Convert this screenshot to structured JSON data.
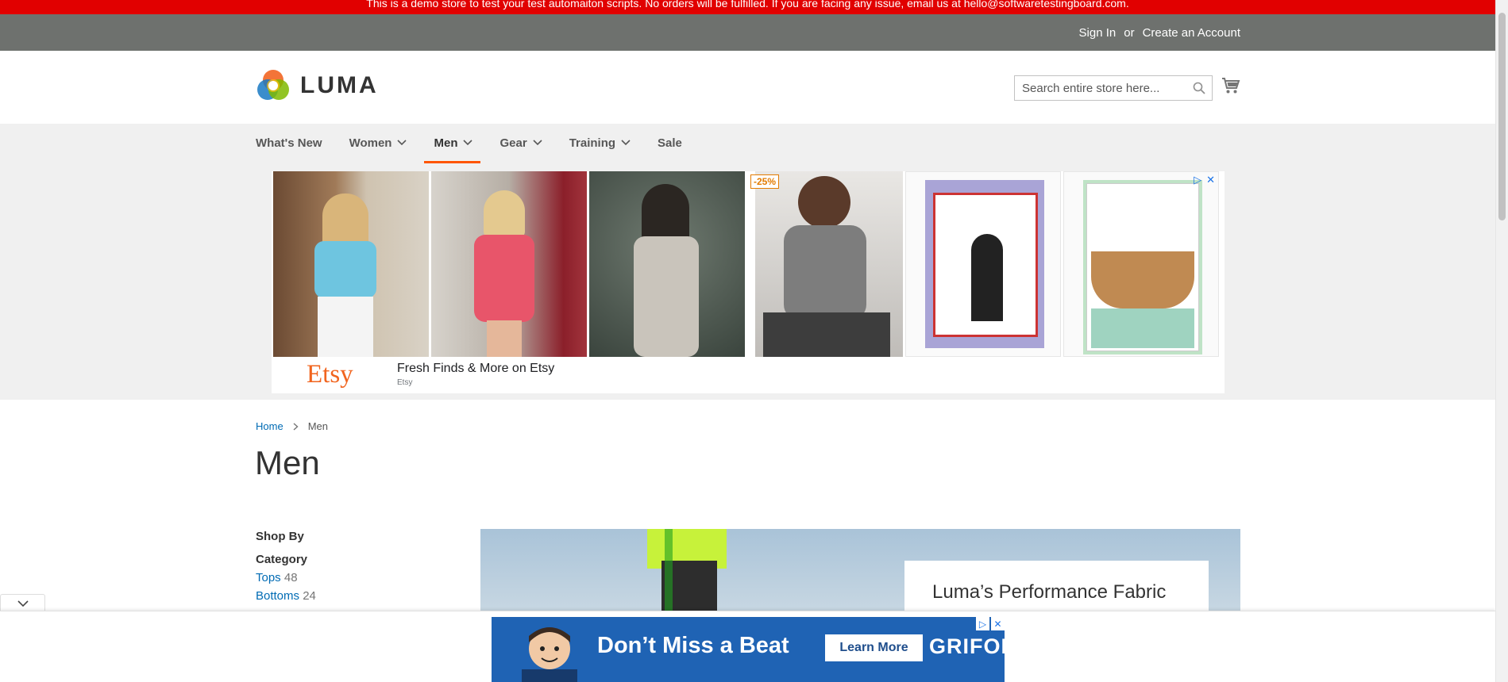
{
  "demo_notice": "This is a demo store to test your test automaiton scripts. No orders will be fulfilled. If you are facing any issue, email us at hello@softwaretestingboard.com.",
  "header_links": {
    "sign_in": "Sign In",
    "or": "or",
    "create_account": "Create an Account"
  },
  "logo": {
    "text": "LUMA"
  },
  "search": {
    "placeholder": "Search entire store here..."
  },
  "nav": {
    "items": [
      {
        "label": "What's New"
      },
      {
        "label": "Women"
      },
      {
        "label": "Men"
      },
      {
        "label": "Gear"
      },
      {
        "label": "Training"
      },
      {
        "label": "Sale"
      }
    ]
  },
  "etsy_ad": {
    "discount": "-25%",
    "logo": "Etsy",
    "title": "Fresh Finds & More on Etsy",
    "source": "Etsy"
  },
  "breadcrumbs": {
    "home": "Home",
    "current": "Men"
  },
  "page_title": "Men",
  "sidebar": {
    "shop_by": "Shop By",
    "filter_title": "Category",
    "categories": [
      {
        "label": "Tops",
        "count": "48"
      },
      {
        "label": "Bottoms",
        "count": "24"
      }
    ]
  },
  "hero": {
    "heading": "Luma’s Performance Fabric"
  },
  "bottom_ad": {
    "headline": "Don’t Miss a Beat",
    "cta": "Learn More",
    "brand": "GRIFOLS"
  },
  "colors": {
    "accent": "#ff5501",
    "link": "#006bb4",
    "banner": "#e10000",
    "panel": "#6e716e"
  }
}
